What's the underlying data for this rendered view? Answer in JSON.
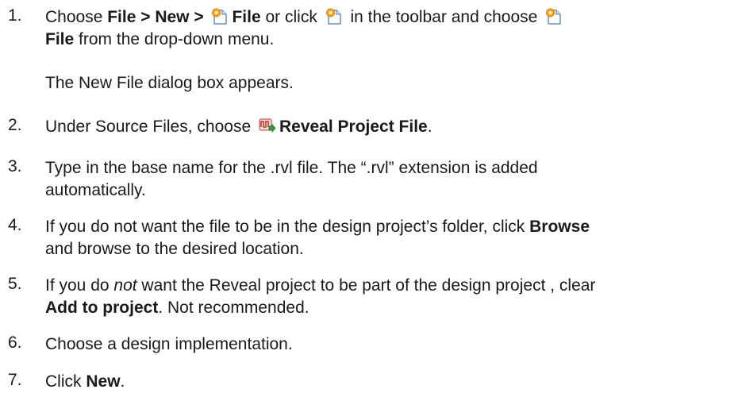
{
  "steps": [
    {
      "num": "1.",
      "l1_a": "Choose ",
      "l1_b": "File > New > ",
      "l1_c": "File",
      "l1_d": " or click ",
      "l1_e": " in the toolbar and choose ",
      "l2_a": "File",
      "l2_b": " from the drop-down menu.",
      "sub": "The New File dialog box appears."
    },
    {
      "num": "2.",
      "a": "Under Source Files, choose ",
      "b": "Reveal Project File",
      "c": "."
    },
    {
      "num": "3.",
      "line1": "Type in the base name for the .rvl file. The “.rvl” extension is added",
      "line2": "automatically."
    },
    {
      "num": "4.",
      "a": "If you do not want the file to be in the design project’s folder, click ",
      "b": "Browse",
      "line2": "and browse to the desired location."
    },
    {
      "num": "5.",
      "a": "If you do ",
      "b": "not",
      "c": " want the Reveal project to be part of the design project , clear",
      "d": "Add to project",
      "e": ". Not recommended."
    },
    {
      "num": "6.",
      "text": "Choose a design implementation."
    },
    {
      "num": "7.",
      "a": "Click ",
      "b": "New",
      "c": "."
    }
  ],
  "icons": {
    "new_file": "new-file-icon",
    "reveal_project": "reveal-project-file-icon"
  }
}
